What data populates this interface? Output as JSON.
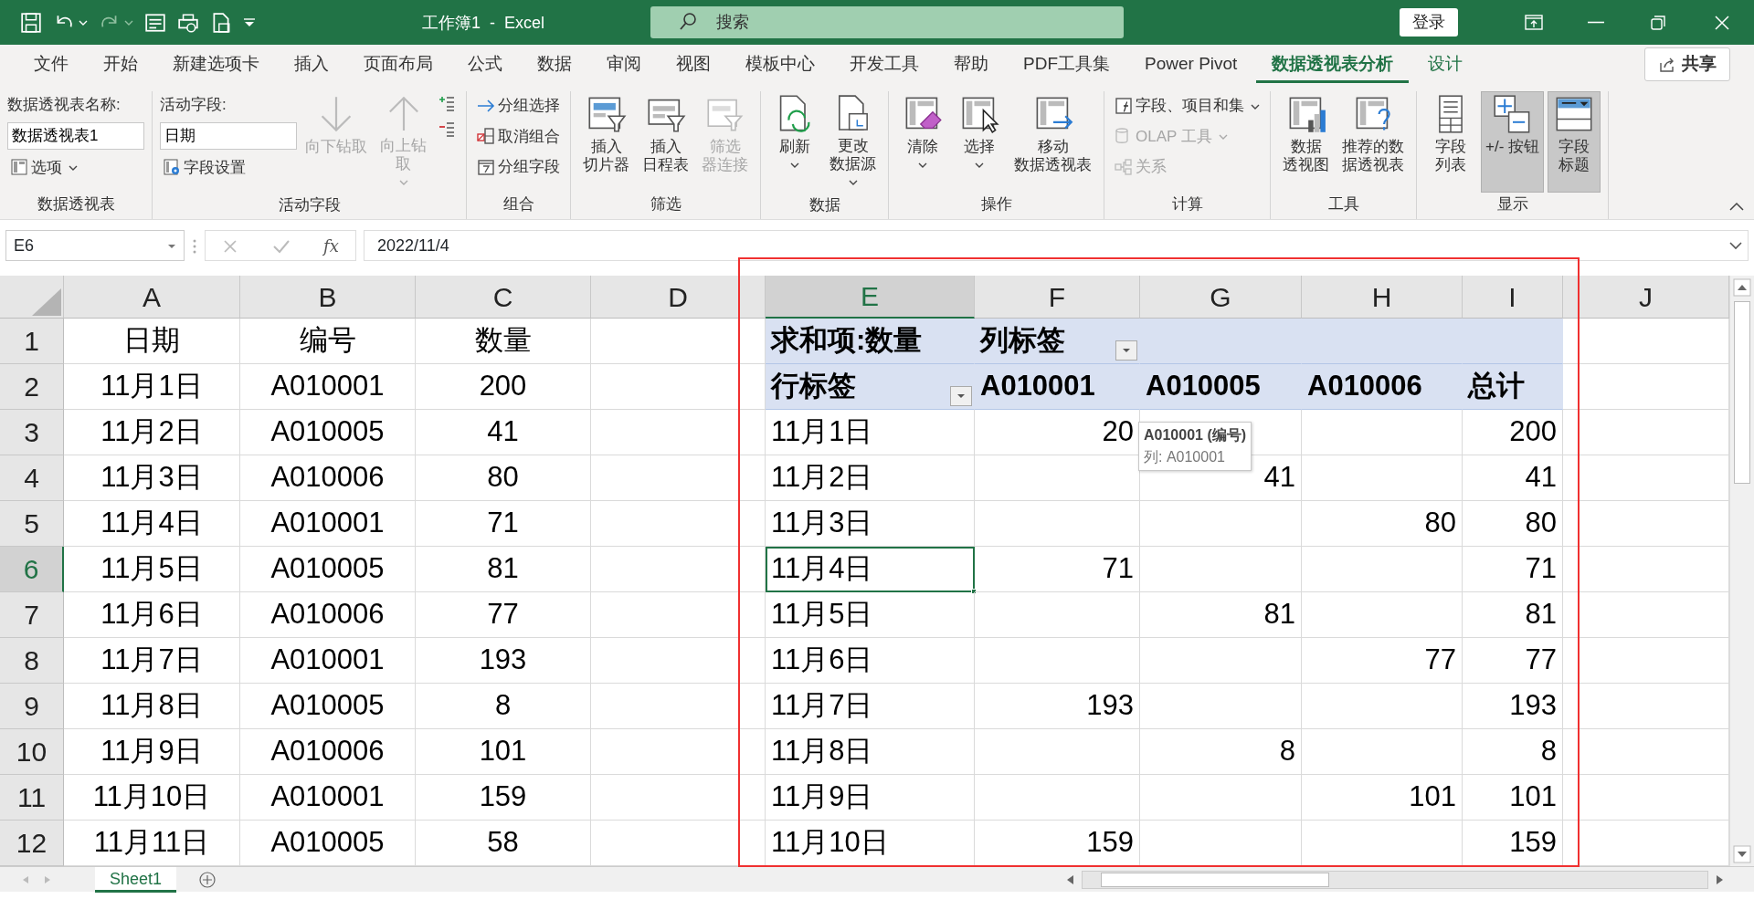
{
  "title_bar": {
    "title": "工作簿1  -  Excel",
    "search": {
      "placeholder": "搜索"
    },
    "login": "登录"
  },
  "tabs": [
    {
      "label": "文件",
      "selected": false,
      "kind": "standard"
    },
    {
      "label": "开始",
      "selected": false,
      "kind": "standard"
    },
    {
      "label": "新建选项卡",
      "selected": false,
      "kind": "standard"
    },
    {
      "label": "插入",
      "selected": false,
      "kind": "standard"
    },
    {
      "label": "页面布局",
      "selected": false,
      "kind": "standard"
    },
    {
      "label": "公式",
      "selected": false,
      "kind": "standard"
    },
    {
      "label": "数据",
      "selected": false,
      "kind": "standard"
    },
    {
      "label": "审阅",
      "selected": false,
      "kind": "standard"
    },
    {
      "label": "视图",
      "selected": false,
      "kind": "standard"
    },
    {
      "label": "模板中心",
      "selected": false,
      "kind": "standard"
    },
    {
      "label": "开发工具",
      "selected": false,
      "kind": "standard"
    },
    {
      "label": "帮助",
      "selected": false,
      "kind": "standard"
    },
    {
      "label": "PDF工具集",
      "selected": false,
      "kind": "standard"
    },
    {
      "label": "Power Pivot",
      "selected": false,
      "kind": "standard"
    },
    {
      "label": "数据透视表分析",
      "selected": true,
      "kind": "contextual"
    },
    {
      "label": "设计",
      "selected": false,
      "kind": "contextual"
    }
  ],
  "share": "共享",
  "ribbon": {
    "groups": [
      {
        "label": "数据透视表",
        "items": [
          {
            "kind": "stack",
            "items": [
              {
                "kind": "caption",
                "text": "数据透视表名称:"
              },
              {
                "kind": "field",
                "value": "数据透视表1"
              },
              {
                "kind": "small",
                "text": "选项",
                "dropdown": true,
                "disabled": false
              }
            ]
          }
        ]
      },
      {
        "label": "活动字段",
        "items": [
          {
            "kind": "stack",
            "items": [
              {
                "kind": "caption",
                "text": "活动字段:"
              },
              {
                "kind": "field",
                "value": "日期"
              },
              {
                "kind": "small",
                "text": "字段设置",
                "dropdown": false,
                "disabled": false
              }
            ]
          },
          {
            "kind": "large",
            "lines": [
              "向下钻取"
            ],
            "dropdown": false,
            "disabled": true,
            "pressed": false
          },
          {
            "kind": "large",
            "lines": [
              "向上钻",
              "取"
            ],
            "dropdown": true,
            "disabled": true,
            "pressed": false
          },
          {
            "kind": "stack",
            "items": [
              {
                "kind": "icon",
                "disabled": false
              },
              {
                "kind": "icon",
                "disabled": false
              }
            ]
          }
        ]
      },
      {
        "label": "组合",
        "items": [
          {
            "kind": "stack",
            "items": [
              {
                "kind": "small",
                "text": "分组选择",
                "dropdown": false,
                "disabled": false
              },
              {
                "kind": "small",
                "text": "取消组合",
                "dropdown": false,
                "disabled": false
              },
              {
                "kind": "small",
                "text": "分组字段",
                "dropdown": false,
                "disabled": false
              }
            ]
          }
        ]
      },
      {
        "label": "筛选",
        "items": [
          {
            "kind": "large",
            "lines": [
              "插入",
              "切片器"
            ],
            "dropdown": false,
            "disabled": false,
            "pressed": false
          },
          {
            "kind": "large",
            "lines": [
              "插入",
              "日程表"
            ],
            "dropdown": false,
            "disabled": false,
            "pressed": false
          },
          {
            "kind": "large",
            "lines": [
              "筛选",
              "器连接"
            ],
            "dropdown": false,
            "disabled": true,
            "pressed": false
          }
        ]
      },
      {
        "label": "数据",
        "items": [
          {
            "kind": "large",
            "lines": [
              "刷新"
            ],
            "dropdown": true,
            "disabled": false,
            "pressed": false
          },
          {
            "kind": "large",
            "lines": [
              "更改",
              "数据源"
            ],
            "dropdown": true,
            "disabled": false,
            "pressed": false
          }
        ]
      },
      {
        "label": "操作",
        "items": [
          {
            "kind": "large",
            "lines": [
              "清除"
            ],
            "dropdown": true,
            "disabled": false,
            "pressed": false
          },
          {
            "kind": "large",
            "lines": [
              "选择"
            ],
            "dropdown": true,
            "disabled": false,
            "pressed": false
          },
          {
            "kind": "large",
            "lines": [
              "移动",
              "数据透视表"
            ],
            "dropdown": false,
            "disabled": false,
            "pressed": false
          }
        ]
      },
      {
        "label": "计算",
        "items": [
          {
            "kind": "stack",
            "items": [
              {
                "kind": "small",
                "text": "字段、项目和集",
                "dropdown": true,
                "disabled": false
              },
              {
                "kind": "small",
                "text": "OLAP 工具",
                "dropdown": true,
                "disabled": true
              },
              {
                "kind": "small",
                "text": "关系",
                "dropdown": false,
                "disabled": true
              }
            ]
          }
        ]
      },
      {
        "label": "工具",
        "items": [
          {
            "kind": "large",
            "lines": [
              "数据",
              "透视图"
            ],
            "dropdown": false,
            "disabled": false,
            "pressed": false
          },
          {
            "kind": "large",
            "lines": [
              "推荐的数",
              "据透视表"
            ],
            "dropdown": false,
            "disabled": false,
            "pressed": false
          }
        ]
      },
      {
        "label": "显示",
        "items": [
          {
            "kind": "large",
            "lines": [
              "字段",
              "列表"
            ],
            "dropdown": false,
            "disabled": false,
            "pressed": false
          },
          {
            "kind": "large",
            "lines": [
              "+/- 按钮"
            ],
            "dropdown": false,
            "disabled": false,
            "pressed": true
          },
          {
            "kind": "large",
            "lines": [
              "字段",
              "标题"
            ],
            "dropdown": false,
            "disabled": false,
            "pressed": true
          }
        ]
      }
    ]
  },
  "formula_bar": {
    "name_box": "E6",
    "function_label": "fx",
    "formula": "2022/11/4"
  },
  "columns": [
    {
      "label": "A",
      "selected": false
    },
    {
      "label": "B",
      "selected": false
    },
    {
      "label": "C",
      "selected": false
    },
    {
      "label": "D",
      "selected": false
    },
    {
      "label": "E",
      "selected": true
    },
    {
      "label": "F",
      "selected": false
    },
    {
      "label": "G",
      "selected": false
    },
    {
      "label": "H",
      "selected": false
    },
    {
      "label": "I",
      "selected": false
    },
    {
      "label": "J",
      "selected": false
    }
  ],
  "rows": [
    {
      "label": "1",
      "selected": false,
      "cells": {
        "A": {
          "text": "日期",
          "kind": "center"
        },
        "B": {
          "text": "编号",
          "kind": "center"
        },
        "C": {
          "text": "数量",
          "kind": "center"
        },
        "E": {
          "text": "求和项:数量",
          "kind": "header",
          "band": true,
          "filter": false
        },
        "F": {
          "text": "列标签",
          "kind": "header",
          "band": true,
          "filter": true
        },
        "G": {
          "band": true,
          "filter": false
        },
        "H": {
          "band": true,
          "filter": false
        },
        "I": {
          "band": true,
          "filter": false
        }
      }
    },
    {
      "label": "2",
      "selected": false,
      "cells": {
        "A": {
          "text": "11月1日",
          "kind": "center"
        },
        "B": {
          "text": "A010001",
          "kind": "center"
        },
        "C": {
          "text": "200",
          "kind": "center"
        },
        "E": {
          "text": "行标签",
          "kind": "header",
          "band": true,
          "filter": true
        },
        "F": {
          "text": "A010001",
          "kind": "header",
          "band": true,
          "filter": false
        },
        "G": {
          "text": "A010005",
          "kind": "header",
          "band": true,
          "filter": false
        },
        "H": {
          "text": "A010006",
          "kind": "header",
          "band": true,
          "filter": false
        },
        "I": {
          "text": "总计",
          "kind": "header",
          "band": true,
          "filter": false
        }
      }
    },
    {
      "label": "3",
      "selected": false,
      "cells": {
        "A": {
          "text": "11月2日",
          "kind": "center"
        },
        "B": {
          "text": "A010005",
          "kind": "center"
        },
        "C": {
          "text": "41",
          "kind": "center"
        },
        "E": {
          "text": "11月1日",
          "kind": "left"
        },
        "F": {
          "text": "20",
          "kind": "right"
        },
        "I": {
          "text": "200",
          "kind": "right"
        }
      }
    },
    {
      "label": "4",
      "selected": false,
      "cells": {
        "A": {
          "text": "11月3日",
          "kind": "center"
        },
        "B": {
          "text": "A010006",
          "kind": "center"
        },
        "C": {
          "text": "80",
          "kind": "center"
        },
        "E": {
          "text": "11月2日",
          "kind": "left"
        },
        "G": {
          "text": "41",
          "kind": "right"
        },
        "I": {
          "text": "41",
          "kind": "right"
        }
      }
    },
    {
      "label": "5",
      "selected": false,
      "cells": {
        "A": {
          "text": "11月4日",
          "kind": "center"
        },
        "B": {
          "text": "A010001",
          "kind": "center"
        },
        "C": {
          "text": "71",
          "kind": "center"
        },
        "E": {
          "text": "11月3日",
          "kind": "left"
        },
        "H": {
          "text": "80",
          "kind": "right"
        },
        "I": {
          "text": "80",
          "kind": "right"
        }
      }
    },
    {
      "label": "6",
      "selected": true,
      "cells": {
        "A": {
          "text": "11月5日",
          "kind": "center"
        },
        "B": {
          "text": "A010005",
          "kind": "center"
        },
        "C": {
          "text": "81",
          "kind": "center"
        },
        "E": {
          "text": "11月4日",
          "kind": "left"
        },
        "F": {
          "text": "71",
          "kind": "right"
        },
        "I": {
          "text": "71",
          "kind": "right"
        }
      }
    },
    {
      "label": "7",
      "selected": false,
      "cells": {
        "A": {
          "text": "11月6日",
          "kind": "center"
        },
        "B": {
          "text": "A010006",
          "kind": "center"
        },
        "C": {
          "text": "77",
          "kind": "center"
        },
        "E": {
          "text": "11月5日",
          "kind": "left"
        },
        "G": {
          "text": "81",
          "kind": "right"
        },
        "I": {
          "text": "81",
          "kind": "right"
        }
      }
    },
    {
      "label": "8",
      "selected": false,
      "cells": {
        "A": {
          "text": "11月7日",
          "kind": "center"
        },
        "B": {
          "text": "A010001",
          "kind": "center"
        },
        "C": {
          "text": "193",
          "kind": "center"
        },
        "E": {
          "text": "11月6日",
          "kind": "left"
        },
        "H": {
          "text": "77",
          "kind": "right"
        },
        "I": {
          "text": "77",
          "kind": "right"
        }
      }
    },
    {
      "label": "9",
      "selected": false,
      "cells": {
        "A": {
          "text": "11月8日",
          "kind": "center"
        },
        "B": {
          "text": "A010005",
          "kind": "center"
        },
        "C": {
          "text": "8",
          "kind": "center"
        },
        "E": {
          "text": "11月7日",
          "kind": "left"
        },
        "F": {
          "text": "193",
          "kind": "right"
        },
        "I": {
          "text": "193",
          "kind": "right"
        }
      }
    },
    {
      "label": "10",
      "selected": false,
      "cells": {
        "A": {
          "text": "11月9日",
          "kind": "center"
        },
        "B": {
          "text": "A010006",
          "kind": "center"
        },
        "C": {
          "text": "101",
          "kind": "center"
        },
        "E": {
          "text": "11月8日",
          "kind": "left"
        },
        "G": {
          "text": "8",
          "kind": "right"
        },
        "I": {
          "text": "8",
          "kind": "right"
        }
      }
    },
    {
      "label": "11",
      "selected": false,
      "cells": {
        "A": {
          "text": "11月10日",
          "kind": "center"
        },
        "B": {
          "text": "A010001",
          "kind": "center"
        },
        "C": {
          "text": "159",
          "kind": "center"
        },
        "E": {
          "text": "11月9日",
          "kind": "left"
        },
        "H": {
          "text": "101",
          "kind": "right"
        },
        "I": {
          "text": "101",
          "kind": "right"
        }
      }
    },
    {
      "label": "12",
      "selected": false,
      "cells": {
        "A": {
          "text": "11月11日",
          "kind": "center"
        },
        "B": {
          "text": "A010005",
          "kind": "center"
        },
        "C": {
          "text": "58",
          "kind": "center"
        },
        "E": {
          "text": "11月10日",
          "kind": "left"
        },
        "F": {
          "text": "159",
          "kind": "right"
        },
        "I": {
          "text": "159",
          "kind": "right"
        }
      }
    }
  ],
  "tooltip": {
    "title": "A010001 (编号)",
    "detail": "列: A010001"
  },
  "sheet_tabs": [
    {
      "label": "Sheet1",
      "selected": true
    }
  ],
  "annotation": {
    "kind": "rectangle"
  }
}
